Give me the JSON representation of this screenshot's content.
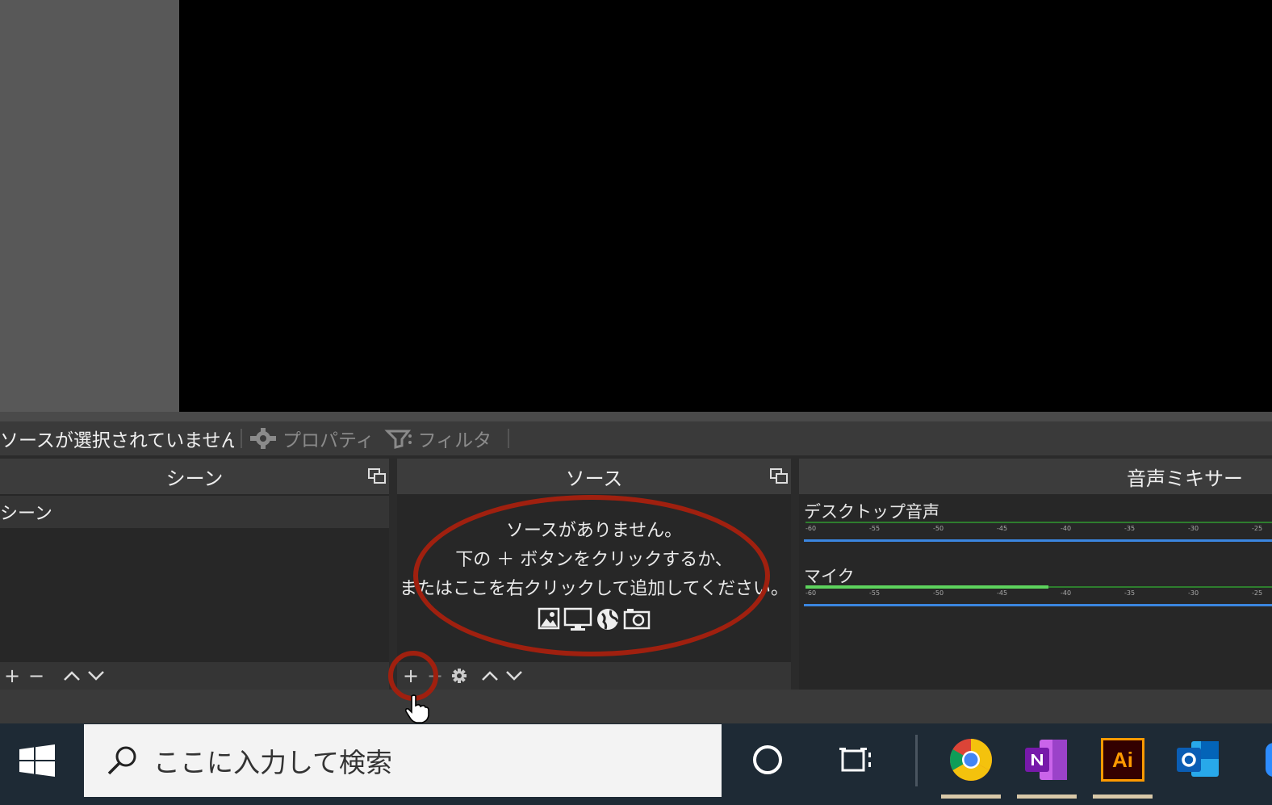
{
  "context_bar": {
    "no_source": "ソースが選択されていません",
    "properties": "プロパティ",
    "filters": "フィルタ"
  },
  "scenes": {
    "title": "シーン",
    "items": [
      "シーン"
    ]
  },
  "sources": {
    "title": "ソース",
    "empty_line1": "ソースがありません。",
    "empty_line2": "下の ＋ ボタンをクリックするか、",
    "empty_line3": "またはここを右クリックして追加してください。"
  },
  "mixer": {
    "title": "音声ミキサー",
    "channels": [
      {
        "name": "デスクトップ音声",
        "level": 0.0
      },
      {
        "name": "マイク",
        "level": 0.52
      }
    ],
    "ticks": [
      "-60",
      "-55",
      "-50",
      "-45",
      "-40",
      "-35",
      "-30",
      "-25"
    ]
  },
  "taskbar": {
    "search_placeholder": "ここに入力して検索",
    "apps": [
      "chrome-icon",
      "onenote-icon",
      "illustrator-icon",
      "outlook-icon"
    ],
    "illustrator_label": "Ai"
  },
  "colors": {
    "annotation": "#a0200f",
    "meter_green": "#5dd35d",
    "slider_blue": "#3b86e0"
  }
}
